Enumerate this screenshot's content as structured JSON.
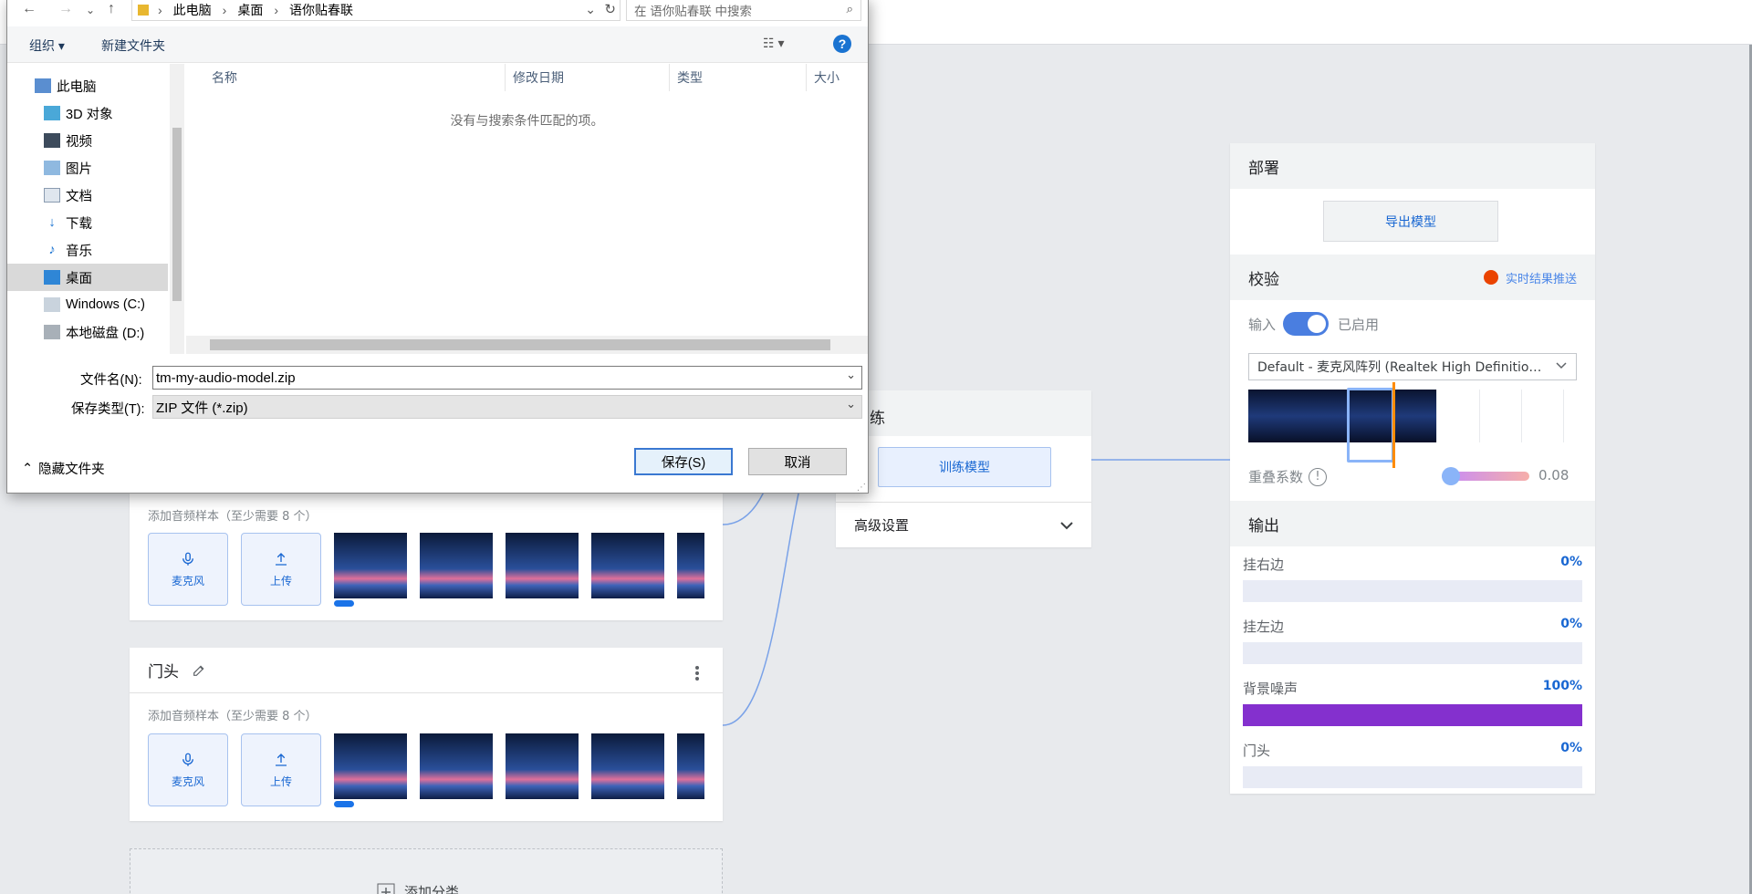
{
  "app": {
    "classes": [
      {
        "hint": "添加音频样本（至少需要 8 个）",
        "mic_label": "麦克风",
        "upload_label": "上传"
      },
      {
        "name": "门头",
        "hint": "添加音频样本（至少需要 8 个）",
        "mic_label": "麦克风",
        "upload_label": "上传"
      }
    ],
    "add_class_label": "添加分类",
    "training": {
      "title": "训练",
      "train_button": "训练模型",
      "advanced_label": "高级设置"
    },
    "deploy": {
      "title": "部署",
      "export_button": "导出模型"
    },
    "validate": {
      "title": "校验",
      "push_label": "实时结果推送",
      "input_label": "输入",
      "toggle_state": "已启用",
      "device": "Default - 麦克风阵列 (Realtek High Definitio…",
      "overlap_label": "重叠系数",
      "overlap_value": "0.08"
    },
    "output": {
      "title": "输出",
      "items": [
        {
          "label": "挂右边",
          "percent": "0%",
          "value": 0
        },
        {
          "label": "挂左边",
          "percent": "0%",
          "value": 0
        },
        {
          "label": "背景噪声",
          "percent": "100%",
          "value": 1
        },
        {
          "label": "门头",
          "percent": "0%",
          "value": 0
        }
      ],
      "fill_color": "#8430ce"
    }
  },
  "dialog": {
    "breadcrumb": [
      "此电脑",
      "桌面",
      "语你贴春联"
    ],
    "search_placeholder": "在 语你贴春联 中搜索",
    "organize_label": "组织",
    "new_folder_label": "新建文件夹",
    "help_glyph": "?",
    "nav_items": [
      {
        "label": "此电脑",
        "icon": "computer-icon"
      },
      {
        "label": "3D 对象",
        "icon": "3d-objects-icon"
      },
      {
        "label": "视频",
        "icon": "video-icon"
      },
      {
        "label": "图片",
        "icon": "pictures-icon"
      },
      {
        "label": "文档",
        "icon": "documents-icon"
      },
      {
        "label": "下载",
        "icon": "download-icon"
      },
      {
        "label": "音乐",
        "icon": "music-icon"
      },
      {
        "label": "桌面",
        "icon": "desktop-icon",
        "selected": true
      },
      {
        "label": "Windows (C:)",
        "icon": "drive-c-icon"
      },
      {
        "label": "本地磁盘 (D:)",
        "icon": "drive-d-icon"
      }
    ],
    "columns": [
      "名称",
      "修改日期",
      "类型",
      "大小"
    ],
    "empty_message": "没有与搜索条件匹配的项。",
    "filename_label": "文件名(N):",
    "filename_value": "tm-my-audio-model.zip",
    "filetype_label": "保存类型(T):",
    "filetype_value": "ZIP 文件 (*.zip)",
    "hide_folders_label": "隐藏文件夹",
    "save_label": "保存(S)",
    "cancel_label": "取消"
  }
}
